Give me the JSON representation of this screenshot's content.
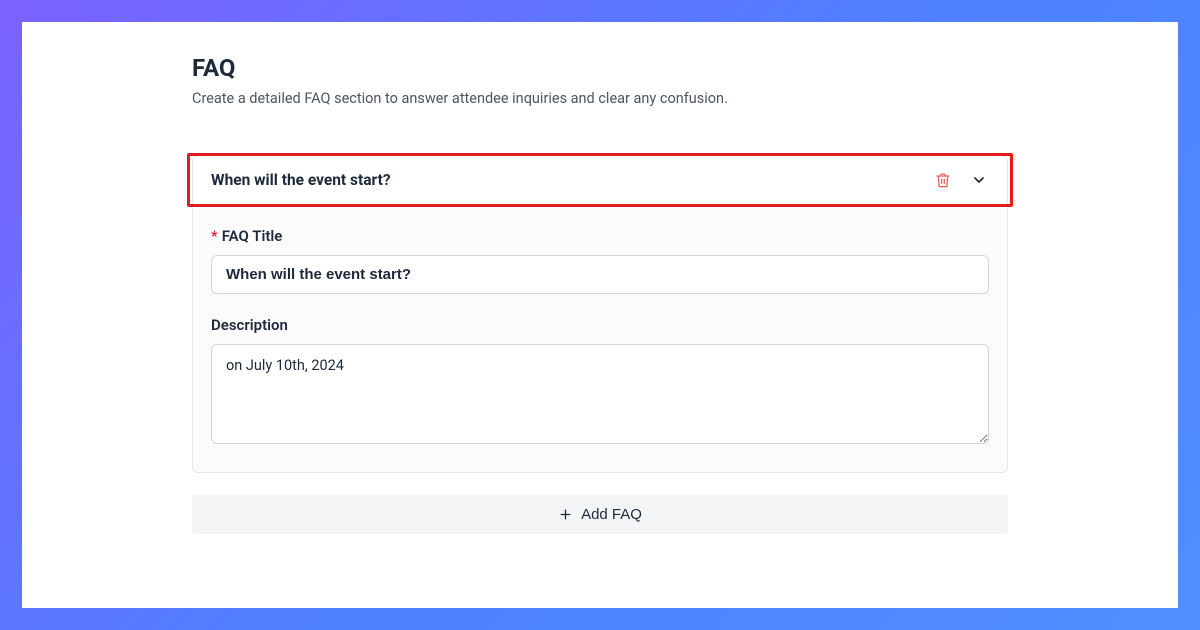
{
  "page": {
    "title": "FAQ",
    "subtitle": "Create a detailed FAQ section to answer attendee inquiries and clear any confusion."
  },
  "faq": {
    "header_title": "When will the event start?",
    "title_field_label": "FAQ Title",
    "title_value": "When will the event start?",
    "description_label": "Description",
    "description_value": "on July 10th, 2024"
  },
  "buttons": {
    "add_faq": "Add FAQ"
  }
}
